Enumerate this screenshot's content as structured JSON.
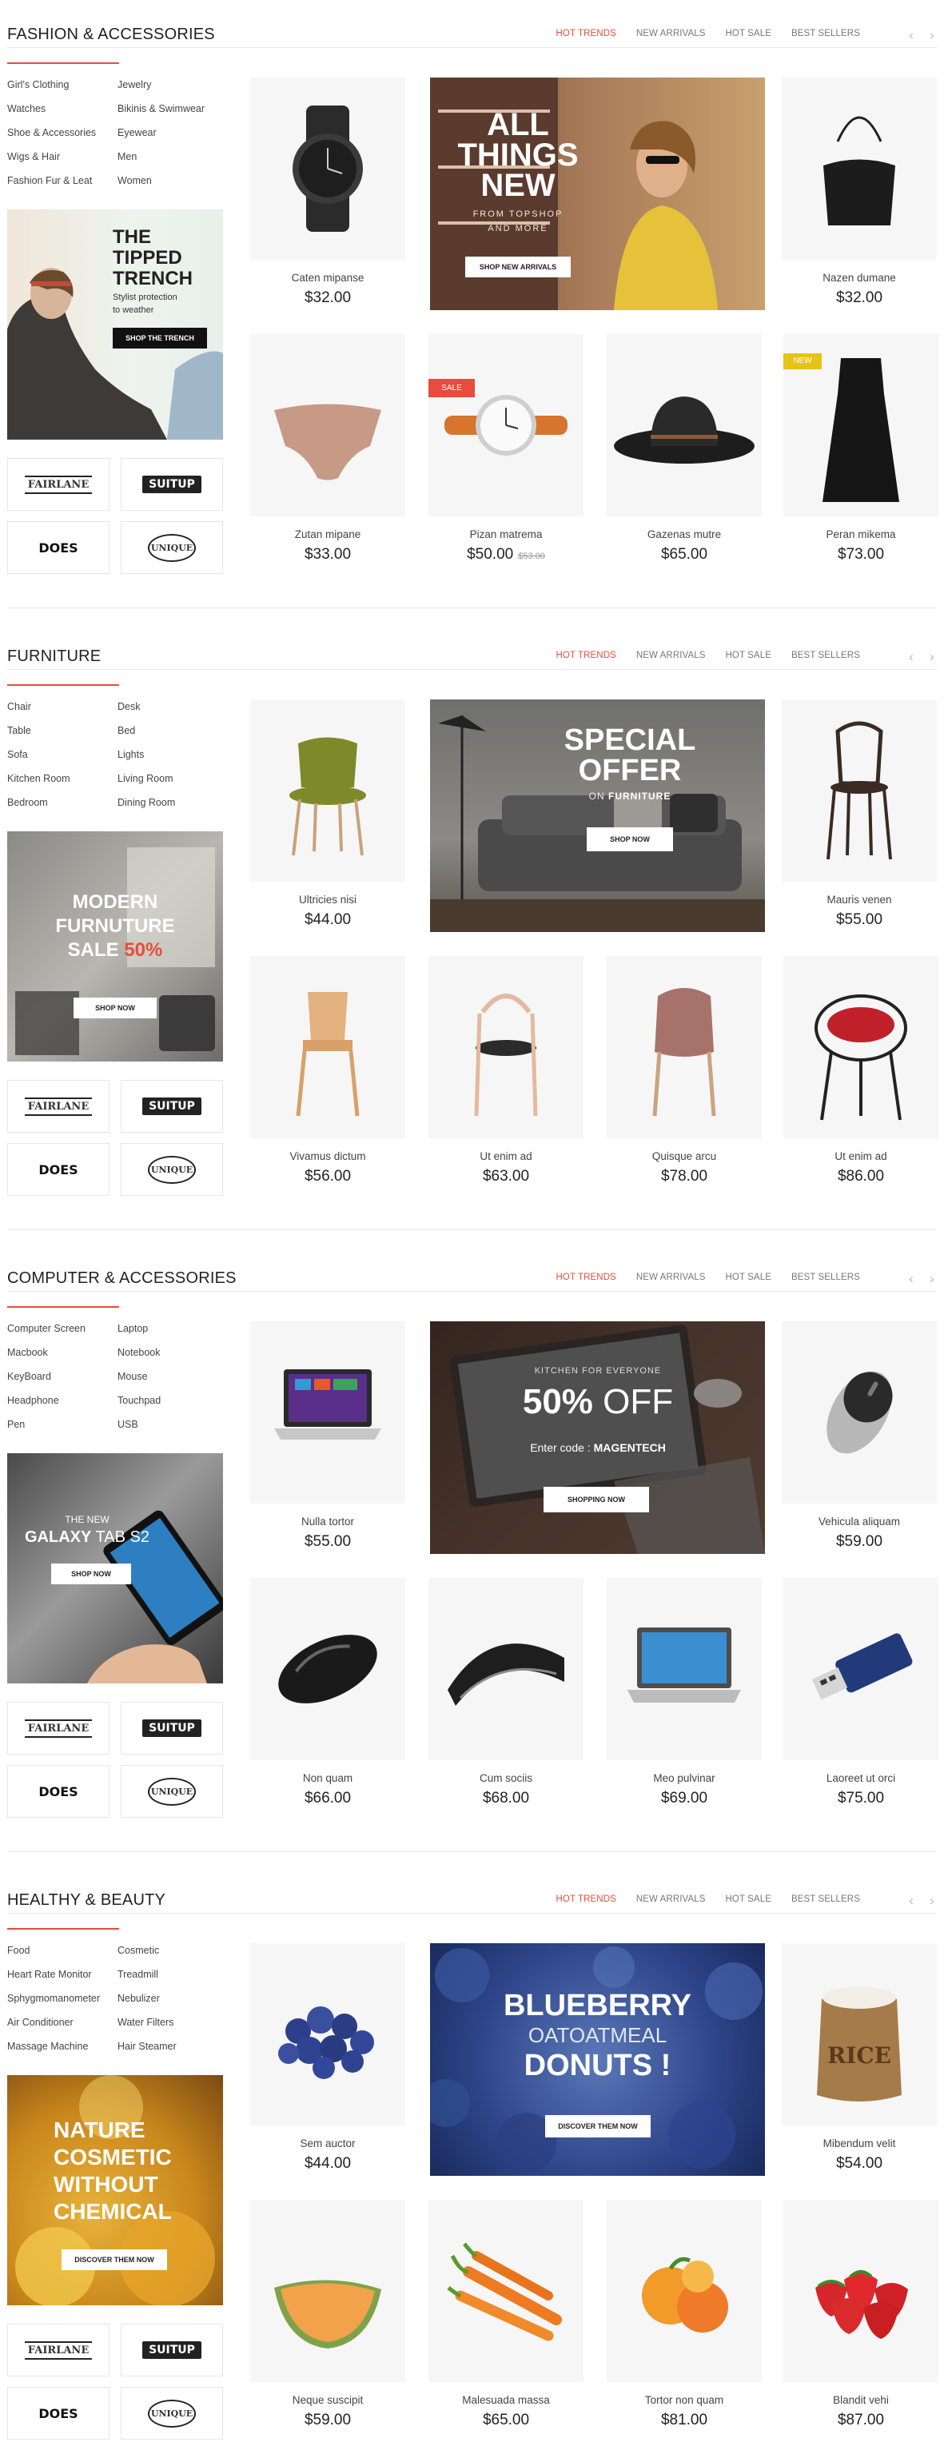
{
  "tabs": [
    "Hot trends",
    "New arrivals",
    "Hot sale",
    "Best sellers"
  ],
  "arrows": {
    "prev": "‹",
    "next": "›"
  },
  "brands": [
    "FAIRLANE",
    "SUITUP",
    "DOES",
    "UNIQUE"
  ],
  "sections": [
    {
      "title": "Fashion & Accessories",
      "categories": [
        "Girl's Clothing",
        "Jewelry",
        "Watches",
        "Bikinis & Swimwear",
        "Shoe & Accessories",
        "Eyewear",
        "Wigs & Hair",
        "Men",
        "Fashion Fur & Leat",
        "Women"
      ],
      "promo": {
        "line1": "THE",
        "line2": "TIPPED",
        "line3": "TRENCH",
        "sub1": "Stylist protection",
        "sub2": "to weather",
        "button": "SHOP THE TRENCH"
      },
      "banner": {
        "line1": "ALL",
        "line2": "THINGS",
        "line3": "NEW",
        "sub1": "FROM TOPSHOP",
        "sub2": "AND MORE",
        "button": "SHOP NEW ARRIVALS"
      },
      "products": [
        {
          "name": "Caten mipanse",
          "price": "$32.00"
        },
        {
          "name": "Nazen dumane",
          "price": "$32.00"
        },
        {
          "name": "Zutan mipane",
          "price": "$33.00"
        },
        {
          "name": "Pizan matrema",
          "price": "$50.00",
          "old": "$53.00",
          "badge": "SALE"
        },
        {
          "name": "Gazenas mutre",
          "price": "$65.00"
        },
        {
          "name": "Peran mikema",
          "price": "$73.00",
          "badge": "NEW"
        }
      ]
    },
    {
      "title": "Furniture",
      "categories": [
        "Chair",
        "Desk",
        "Table",
        "Bed",
        "Sofa",
        "Lights",
        "Kitchen Room",
        "Living Room",
        "Bedroom",
        "Dining Room"
      ],
      "promo": {
        "line1": "MODERN",
        "line2": "FURNUTURE",
        "line3": "SALE",
        "pct": "50%",
        "button": "SHOP NOW"
      },
      "banner": {
        "line1": "SPECIAL",
        "line2": "OFFER",
        "on": "ON",
        "strong": "FURNITURE",
        "button": "SHOP NOW"
      },
      "products": [
        {
          "name": "Ultricies nisi",
          "price": "$44.00"
        },
        {
          "name": "Mauris venen",
          "price": "$55.00"
        },
        {
          "name": "Vivamus dictum",
          "price": "$56.00"
        },
        {
          "name": "Ut enim ad",
          "price": "$63.00"
        },
        {
          "name": "Quisque arcu",
          "price": "$78.00"
        },
        {
          "name": "Ut enim ad",
          "price": "$86.00"
        }
      ]
    },
    {
      "title": "Computer & Accessories",
      "categories": [
        "Computer Screen",
        "Laptop",
        "Macbook",
        "Notebook",
        "KeyBoard",
        "Mouse",
        "Headphone",
        "Touchpad",
        "Pen",
        "USB"
      ],
      "promo": {
        "line1": "THE NEW",
        "line2": "GALAXY",
        "line3": "TAB S2",
        "button": "SHOP NOW"
      },
      "banner": {
        "kicker": "KITCHEN FOR EVERYONE",
        "pct": "50%",
        "off": "OFF",
        "code_label": "Enter code :",
        "code": "MAGENTECH",
        "button": "SHOPPING NOW"
      },
      "products": [
        {
          "name": "Nulla tortor",
          "price": "$55.00"
        },
        {
          "name": "Vehicula aliquam",
          "price": "$59.00"
        },
        {
          "name": "Non quam",
          "price": "$66.00"
        },
        {
          "name": "Cum sociis",
          "price": "$68.00"
        },
        {
          "name": "Meo pulvinar",
          "price": "$69.00"
        },
        {
          "name": "Laoreet ut orci",
          "price": "$75.00"
        }
      ]
    },
    {
      "title": "Healthy & Beauty",
      "categories": [
        "Food",
        "Cosmetic",
        "Heart Rate Monitor",
        "Treadmill",
        "Sphygmomanometer",
        "Nebulizer",
        "Air Conditioner",
        "Water Filters",
        "Massage Machine",
        "Hair Steamer"
      ],
      "promo": {
        "line1": "NATURE",
        "line2": "COSMETIC",
        "line3": "WITHOUT",
        "line4": "CHEMICAL",
        "button": "DISCOVER THEM NOW"
      },
      "banner": {
        "line1": "BLUEBERRY",
        "line2": "OATOATMEAL",
        "line3": "DONUTS !",
        "button": "DISCOVER THEM NOW"
      },
      "products": [
        {
          "name": "Sem auctor",
          "price": "$44.00"
        },
        {
          "name": "Mibendum velit",
          "price": "$54.00"
        },
        {
          "name": "Neque suscipit",
          "price": "$59.00"
        },
        {
          "name": "Malesuada massa",
          "price": "$65.00"
        },
        {
          "name": "Tortor non quam",
          "price": "$81.00"
        },
        {
          "name": "Blandit vehi",
          "price": "$87.00"
        }
      ]
    }
  ],
  "colors": {
    "accent": "#e74c3c",
    "new_badge": "#e6c416",
    "border": "#e8e8e8"
  }
}
